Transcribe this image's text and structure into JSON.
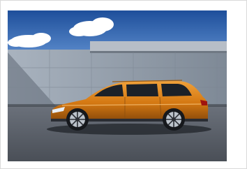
{
  "image": {
    "subject": "car-photo",
    "colors": {
      "sky": "#2d6ab8",
      "wall": "#8c97a5",
      "ground": "#5b616b",
      "car_body": "#d97e16",
      "car_shadow": "#20242a"
    }
  }
}
